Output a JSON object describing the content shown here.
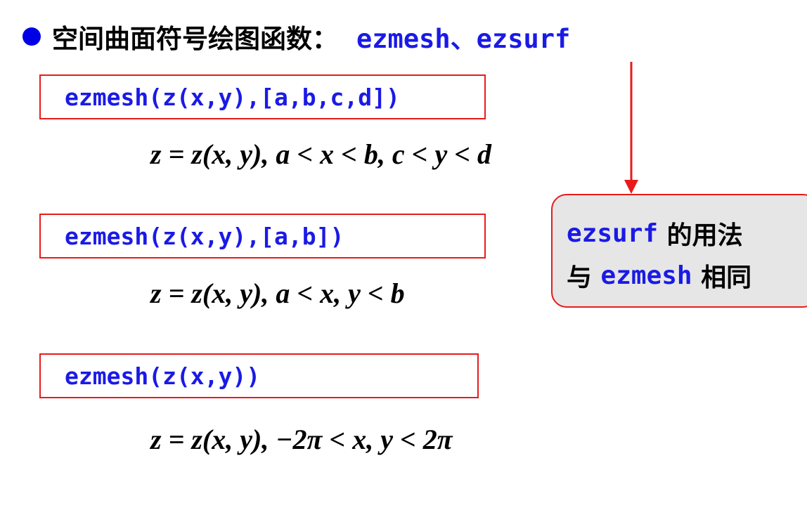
{
  "heading": {
    "text": "空间曲面符号绘图函数：",
    "code": "ezmesh、ezsurf"
  },
  "blocks": [
    {
      "code": "ezmesh(z(x,y),[a,b,c,d])",
      "formula": "z = z(x, y), a < x < b, c < y < d"
    },
    {
      "code": "ezmesh(z(x,y),[a,b])",
      "formula": "z = z(x, y), a < x, y < b"
    },
    {
      "code": "ezmesh(z(x,y))",
      "formula": "z = z(x, y), −2π < x, y < 2π"
    }
  ],
  "callout": {
    "line1_code": "ezsurf",
    "line1_text": " 的用法",
    "line2_text": "与 ",
    "line2_code": "ezmesh",
    "line2_text2": " 相同"
  },
  "colors": {
    "code_blue": "#1a1ae6",
    "bullet_blue": "#0000e6",
    "border_red": "#e81b1b",
    "callout_bg": "#e6e6e6"
  }
}
